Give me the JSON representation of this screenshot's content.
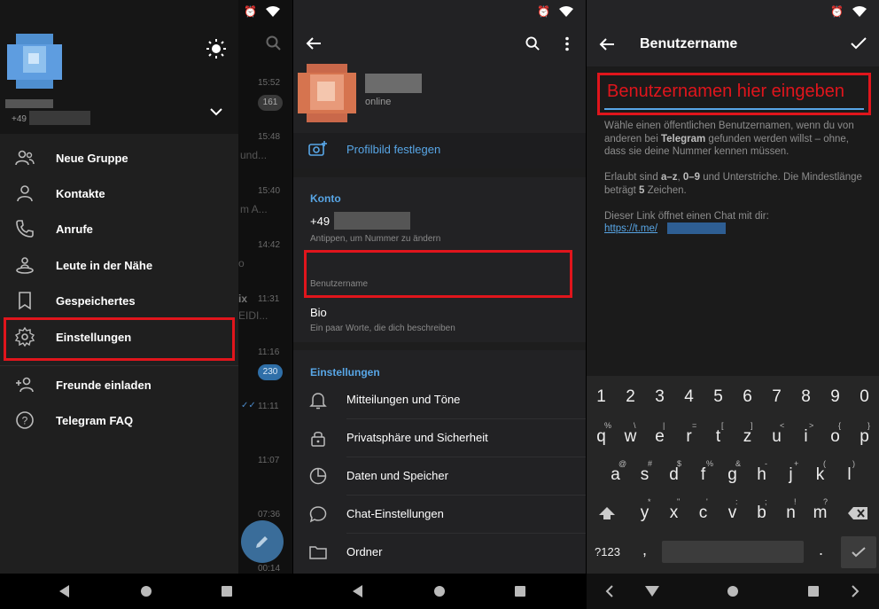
{
  "panel1": {
    "phone_prefix": "+49",
    "menu": [
      {
        "label": "Neue Gruppe",
        "icon": "group-icon"
      },
      {
        "label": "Kontakte",
        "icon": "person-icon"
      },
      {
        "label": "Anrufe",
        "icon": "phone-icon"
      },
      {
        "label": "Leute in der Nähe",
        "icon": "people-nearby-icon"
      },
      {
        "label": "Gespeichertes",
        "icon": "bookmark-icon"
      },
      {
        "label": "Einstellungen",
        "icon": "gear-icon"
      },
      {
        "label": "Freunde einladen",
        "icon": "add-person-icon"
      },
      {
        "label": "Telegram FAQ",
        "icon": "help-icon"
      }
    ],
    "chat_times": [
      "15:52",
      "15:48",
      "15:40",
      "14:42",
      "11:31",
      "11:16",
      "11:11",
      "11:07",
      "07:36",
      "00:14"
    ],
    "chat_snippets": [
      "und...",
      "m A...",
      "o",
      "ix",
      "EIDI..."
    ],
    "badges": [
      "161",
      "230"
    ]
  },
  "panel2": {
    "status": "online",
    "set_photo": "Profilbild festlegen",
    "konto_title": "Konto",
    "phone_prefix": "+49",
    "phone_hint": "Antippen, um Nummer zu ändern",
    "username_label": "Benutzername",
    "bio_title": "Bio",
    "bio_hint": "Ein paar Worte, die dich beschreiben",
    "settings_title": "Einstellungen",
    "settings": [
      {
        "label": "Mitteilungen und Töne",
        "icon": "bell-icon"
      },
      {
        "label": "Privatsphäre und Sicherheit",
        "icon": "lock-icon"
      },
      {
        "label": "Daten und Speicher",
        "icon": "pie-chart-icon"
      },
      {
        "label": "Chat-Einstellungen",
        "icon": "chat-bubble-icon"
      },
      {
        "label": "Ordner",
        "icon": "folder-icon"
      }
    ]
  },
  "panel3": {
    "title": "Benutzername",
    "input_value": "Benutzernamen hier eingeben",
    "info1_a": "Wähle einen öffentlichen Benutzernamen, wenn du von anderen bei ",
    "info1_bold": "Telegram",
    "info1_b": " gefunden werden willst – ohne, dass sie deine Nummer kennen müssen.",
    "info2_a": "Erlaubt sind ",
    "info2_b1": "a–z",
    "info2_c": ", ",
    "info2_b2": "0–9",
    "info2_d": " und Unterstriche. Die Mindestlänge beträgt ",
    "info2_b3": "5",
    "info2_e": " Zeichen.",
    "info3": "Dieser Link öffnet einen Chat mit dir:",
    "link": "https://t.me/",
    "keyboard": {
      "numbers": [
        "1",
        "2",
        "3",
        "4",
        "5",
        "6",
        "7",
        "8",
        "9",
        "0"
      ],
      "row1": [
        "q",
        "w",
        "e",
        "r",
        "t",
        "z",
        "u",
        "i",
        "o",
        "p"
      ],
      "row1_hints": [
        "%",
        "\\",
        "|",
        "=",
        "[",
        "]",
        "<",
        ">",
        "{",
        "}"
      ],
      "row2": [
        "a",
        "s",
        "d",
        "f",
        "g",
        "h",
        "j",
        "k",
        "l"
      ],
      "row2_hints": [
        "@",
        "#",
        "$",
        "%",
        "&",
        "-",
        "+",
        "(",
        ")"
      ],
      "row3": [
        "y",
        "x",
        "c",
        "v",
        "b",
        "n",
        "m"
      ],
      "row3_hints": [
        "*",
        "\"",
        "'",
        ":",
        ";",
        "!",
        "?"
      ],
      "symbols_key": "?123",
      "comma": ",",
      "period": "."
    }
  },
  "colors": {
    "accent_blue": "#58a6e6",
    "highlight_red": "#e0151c",
    "background": "#1d1d1d"
  }
}
